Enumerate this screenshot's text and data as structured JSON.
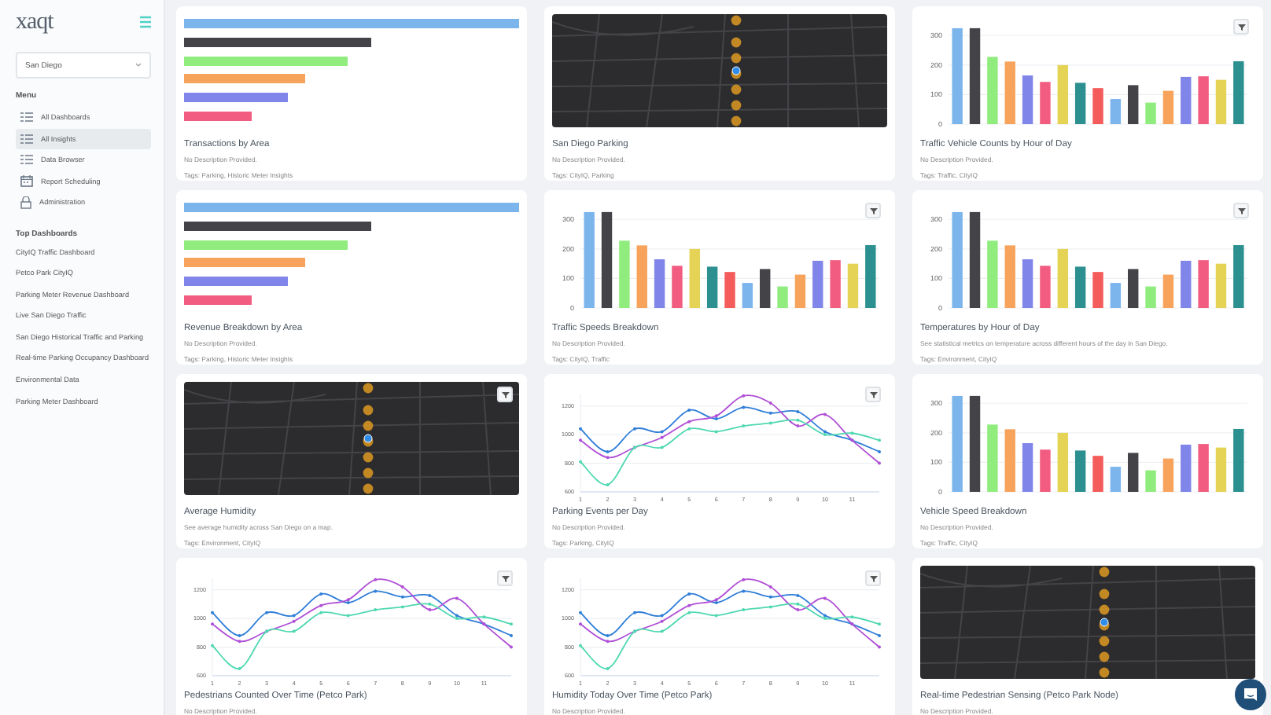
{
  "sidebar": {
    "logo": "xaqt",
    "city_select": {
      "value": "San Diego"
    },
    "menu_heading": "Menu",
    "menu": [
      {
        "label": "All Dashboards",
        "kind": "list",
        "selected": false
      },
      {
        "label": "All Insights",
        "kind": "list",
        "selected": true
      },
      {
        "label": "Data Browser",
        "kind": "list",
        "selected": false
      },
      {
        "label": "Report Scheduling",
        "kind": "calendar",
        "selected": false
      },
      {
        "label": "Administration",
        "kind": "lock",
        "selected": false
      }
    ],
    "top_heading": "Top Dashboards",
    "top_dashboards": [
      "CityIQ Traffic Dashboard",
      "Petco Park CityIQ",
      "Parking Meter Revenue Dashboard",
      "Live San Diego Traffic",
      "San Diego Historical Traffic and Parking",
      "Real-time Parking Occupancy Dashboard",
      "Environmental Data",
      "Parking Meter Dashboard"
    ]
  },
  "cards": [
    {
      "kind": "hbar",
      "filter": false,
      "title": "Transactions by Area",
      "description": "No Description Provided.",
      "tags": "Tags: Parking, Historic Meter Insights"
    },
    {
      "kind": "map",
      "filter": false,
      "title": "San Diego Parking",
      "description": "No Description Provided.",
      "tags": "Tags: CityIQ, Parking"
    },
    {
      "kind": "chart",
      "filter": true,
      "title": "Traffic Vehicle Counts by Hour of Day",
      "description": "No Description Provided.",
      "tags": "Tags: Traffic, CityIQ",
      "chart_data": {
        "type": "bar",
        "grid": true,
        "ylim": [
          0,
          330
        ],
        "yticks": [
          0,
          100,
          200,
          300
        ],
        "values": [
          325,
          325,
          228,
          212,
          165,
          143,
          200,
          140,
          122,
          85,
          132,
          73,
          113,
          160,
          162,
          150,
          213
        ],
        "colors": [
          "#7cb5ec",
          "#434348",
          "#90ed7d",
          "#f7a35c",
          "#8085e9",
          "#f15c80",
          "#e4d354",
          "#2b908f",
          "#f45b5b",
          "#7cb5ec",
          "#434348",
          "#90ed7d",
          "#f7a35c",
          "#8085e9",
          "#f15c80",
          "#e4d354",
          "#2b908f"
        ]
      }
    },
    {
      "kind": "hbar",
      "filter": false,
      "title": "Revenue Breakdown by Area",
      "description": "No Description Provided.",
      "tags": "Tags: Parking, Historic Meter Insights"
    },
    {
      "kind": "chart",
      "filter": true,
      "title": "Traffic Speeds Breakdown",
      "description": "No Description Provided.",
      "tags": "Tags: CityIQ, Traffic",
      "chart_data": {
        "type": "bar",
        "grid": true,
        "ylim": [
          0,
          330
        ],
        "yticks": [
          0,
          100,
          200,
          300
        ],
        "values": [
          325,
          325,
          228,
          212,
          165,
          143,
          200,
          140,
          122,
          85,
          132,
          73,
          113,
          160,
          162,
          150,
          213
        ],
        "colors": [
          "#7cb5ec",
          "#434348",
          "#90ed7d",
          "#f7a35c",
          "#8085e9",
          "#f15c80",
          "#e4d354",
          "#2b908f",
          "#f45b5b",
          "#7cb5ec",
          "#434348",
          "#90ed7d",
          "#f7a35c",
          "#8085e9",
          "#f15c80",
          "#e4d354",
          "#2b908f"
        ]
      }
    },
    {
      "kind": "chart",
      "filter": true,
      "title": "Temperatures by Hour of Day",
      "description": "See statistical metrics on temperature across different hours of the day in San Diego.",
      "tags": "Tags: Environment, CityIQ",
      "chart_data": {
        "type": "bar",
        "grid": true,
        "ylim": [
          0,
          330
        ],
        "yticks": [
          0,
          100,
          200,
          300
        ],
        "values": [
          325,
          325,
          228,
          212,
          165,
          143,
          200,
          140,
          122,
          85,
          132,
          73,
          113,
          160,
          162,
          150,
          213
        ],
        "colors": [
          "#7cb5ec",
          "#434348",
          "#90ed7d",
          "#f7a35c",
          "#8085e9",
          "#f15c80",
          "#e4d354",
          "#2b908f",
          "#f45b5b",
          "#7cb5ec",
          "#434348",
          "#90ed7d",
          "#f7a35c",
          "#8085e9",
          "#f15c80",
          "#e4d354",
          "#2b908f"
        ]
      }
    },
    {
      "kind": "map",
      "filter": true,
      "title": "Average Humidity",
      "description": "See average humidity across San Diego on a map.",
      "tags": "Tags: Environment, CityIQ"
    },
    {
      "kind": "chart",
      "filter": true,
      "title": "Parking Events per Day",
      "description": "No Description Provided.",
      "tags": "Tags: Parking, CityIQ",
      "chart_data": {
        "type": "line",
        "grid": true,
        "ylim": [
          600,
          1280
        ],
        "x": [
          1,
          2,
          3,
          4,
          5,
          6,
          7,
          8,
          9,
          10,
          11,
          12
        ],
        "xlim": [
          1,
          12
        ],
        "xticks": [
          1,
          2,
          3,
          4,
          5,
          6,
          7,
          8,
          9,
          10,
          11
        ],
        "yticks": [
          600,
          800,
          1000,
          1200
        ],
        "series": [
          {
            "color": "#2f7ed8",
            "values": [
              1040,
              880,
              1040,
              1020,
              1170,
              1110,
              1190,
              1150,
              1160,
              1020,
              960,
              880
            ]
          },
          {
            "color": "#b04fd6",
            "values": [
              960,
              840,
              910,
              980,
              1090,
              1130,
              1270,
              1220,
              1060,
              1140,
              960,
              800
            ]
          },
          {
            "color": "#4fd8b0",
            "values": [
              810,
              650,
              910,
              910,
              1040,
              1020,
              1060,
              1080,
              1100,
              1000,
              1010,
              960
            ]
          }
        ]
      }
    },
    {
      "kind": "chart",
      "filter": false,
      "title": "Vehicle Speed Breakdown",
      "description": "No Description Provided.",
      "tags": "Tags: Traffic, CityIQ",
      "chart_data": {
        "type": "bar",
        "grid": true,
        "ylim": [
          0,
          330
        ],
        "yticks": [
          0,
          100,
          200,
          300
        ],
        "values": [
          325,
          325,
          228,
          212,
          165,
          143,
          200,
          140,
          122,
          85,
          132,
          73,
          113,
          160,
          162,
          150,
          213
        ],
        "colors": [
          "#7cb5ec",
          "#434348",
          "#90ed7d",
          "#f7a35c",
          "#8085e9",
          "#f15c80",
          "#e4d354",
          "#2b908f",
          "#f45b5b",
          "#7cb5ec",
          "#434348",
          "#90ed7d",
          "#f7a35c",
          "#8085e9",
          "#f15c80",
          "#e4d354",
          "#2b908f"
        ]
      }
    },
    {
      "kind": "chart",
      "filter": true,
      "title": "Pedestrians Counted Over Time (Petco Park)",
      "description": "No Description Provided.",
      "chart_data": {
        "type": "line",
        "grid": true,
        "ylim": [
          600,
          1280
        ],
        "x": [
          1,
          2,
          3,
          4,
          5,
          6,
          7,
          8,
          9,
          10,
          11,
          12
        ],
        "xlim": [
          1,
          12
        ],
        "xticks": [
          1,
          2,
          3,
          4,
          5,
          6,
          7,
          8,
          9,
          10,
          11
        ],
        "yticks": [
          600,
          800,
          1000,
          1200
        ],
        "series": [
          {
            "color": "#2f7ed8",
            "values": [
              1040,
              880,
              1040,
              1020,
              1170,
              1110,
              1190,
              1150,
              1160,
              1020,
              960,
              880
            ]
          },
          {
            "color": "#b04fd6",
            "values": [
              960,
              840,
              910,
              980,
              1090,
              1130,
              1270,
              1220,
              1060,
              1140,
              960,
              800
            ]
          },
          {
            "color": "#4fd8b0",
            "values": [
              810,
              650,
              910,
              910,
              1040,
              1020,
              1060,
              1080,
              1100,
              1000,
              1010,
              960
            ]
          }
        ]
      }
    },
    {
      "kind": "chart",
      "filter": true,
      "title": "Humidity Today Over Time (Petco Park)",
      "description": "No Description Provided.",
      "chart_data": {
        "type": "line",
        "grid": true,
        "ylim": [
          600,
          1280
        ],
        "x": [
          1,
          2,
          3,
          4,
          5,
          6,
          7,
          8,
          9,
          10,
          11,
          12
        ],
        "xlim": [
          1,
          12
        ],
        "xticks": [
          1,
          2,
          3,
          4,
          5,
          6,
          7,
          8,
          9,
          10,
          11
        ],
        "yticks": [
          600,
          800,
          1000,
          1200
        ],
        "series": [
          {
            "color": "#2f7ed8",
            "values": [
              1040,
              880,
              1040,
              1020,
              1170,
              1110,
              1190,
              1150,
              1160,
              1020,
              960,
              880
            ]
          },
          {
            "color": "#b04fd6",
            "values": [
              960,
              840,
              910,
              980,
              1090,
              1130,
              1270,
              1220,
              1060,
              1140,
              960,
              800
            ]
          },
          {
            "color": "#4fd8b0",
            "values": [
              810,
              650,
              910,
              910,
              1040,
              1020,
              1060,
              1080,
              1100,
              1000,
              1010,
              960
            ]
          }
        ]
      }
    },
    {
      "kind": "map",
      "filter": false,
      "title": "Real-time Pedestrian Sensing (Petco Park Node)",
      "description": "No Description Provided."
    }
  ]
}
